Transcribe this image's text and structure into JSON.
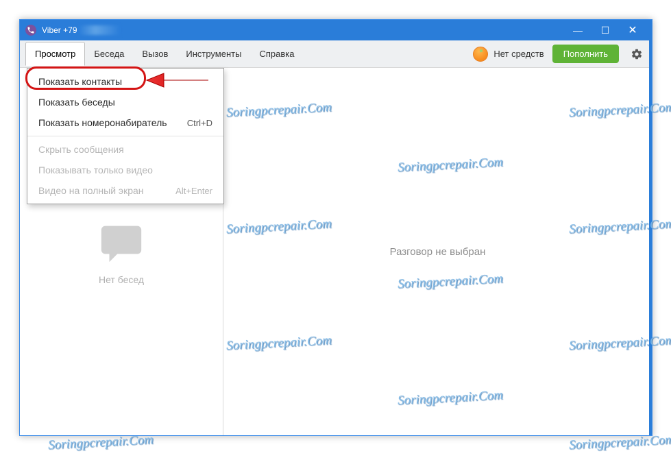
{
  "window": {
    "title_prefix": "Viber +79"
  },
  "menubar": {
    "view": "Просмотр",
    "chat": "Беседа",
    "call": "Вызов",
    "tools": "Инструменты",
    "help": "Справка"
  },
  "balance": {
    "text": "Нет средств",
    "topup_label": "Пополнить"
  },
  "dropdown": {
    "items": [
      {
        "label": "Показать контакты",
        "shortcut": "",
        "disabled": false
      },
      {
        "label": "Показать беседы",
        "shortcut": "",
        "disabled": false
      },
      {
        "label": "Показать номеронабиратель",
        "shortcut": "Ctrl+D",
        "disabled": false
      },
      {
        "label": "Скрыть сообщения",
        "shortcut": "",
        "disabled": true
      },
      {
        "label": "Показывать только видео",
        "shortcut": "",
        "disabled": true
      },
      {
        "label": "Видео на полный экран",
        "shortcut": "Alt+Enter",
        "disabled": true
      }
    ]
  },
  "sidebar": {
    "empty_text": "Нет бесед"
  },
  "main": {
    "no_conversation": "Разговор не выбран"
  },
  "watermark": "Soringpcrepair.Com"
}
